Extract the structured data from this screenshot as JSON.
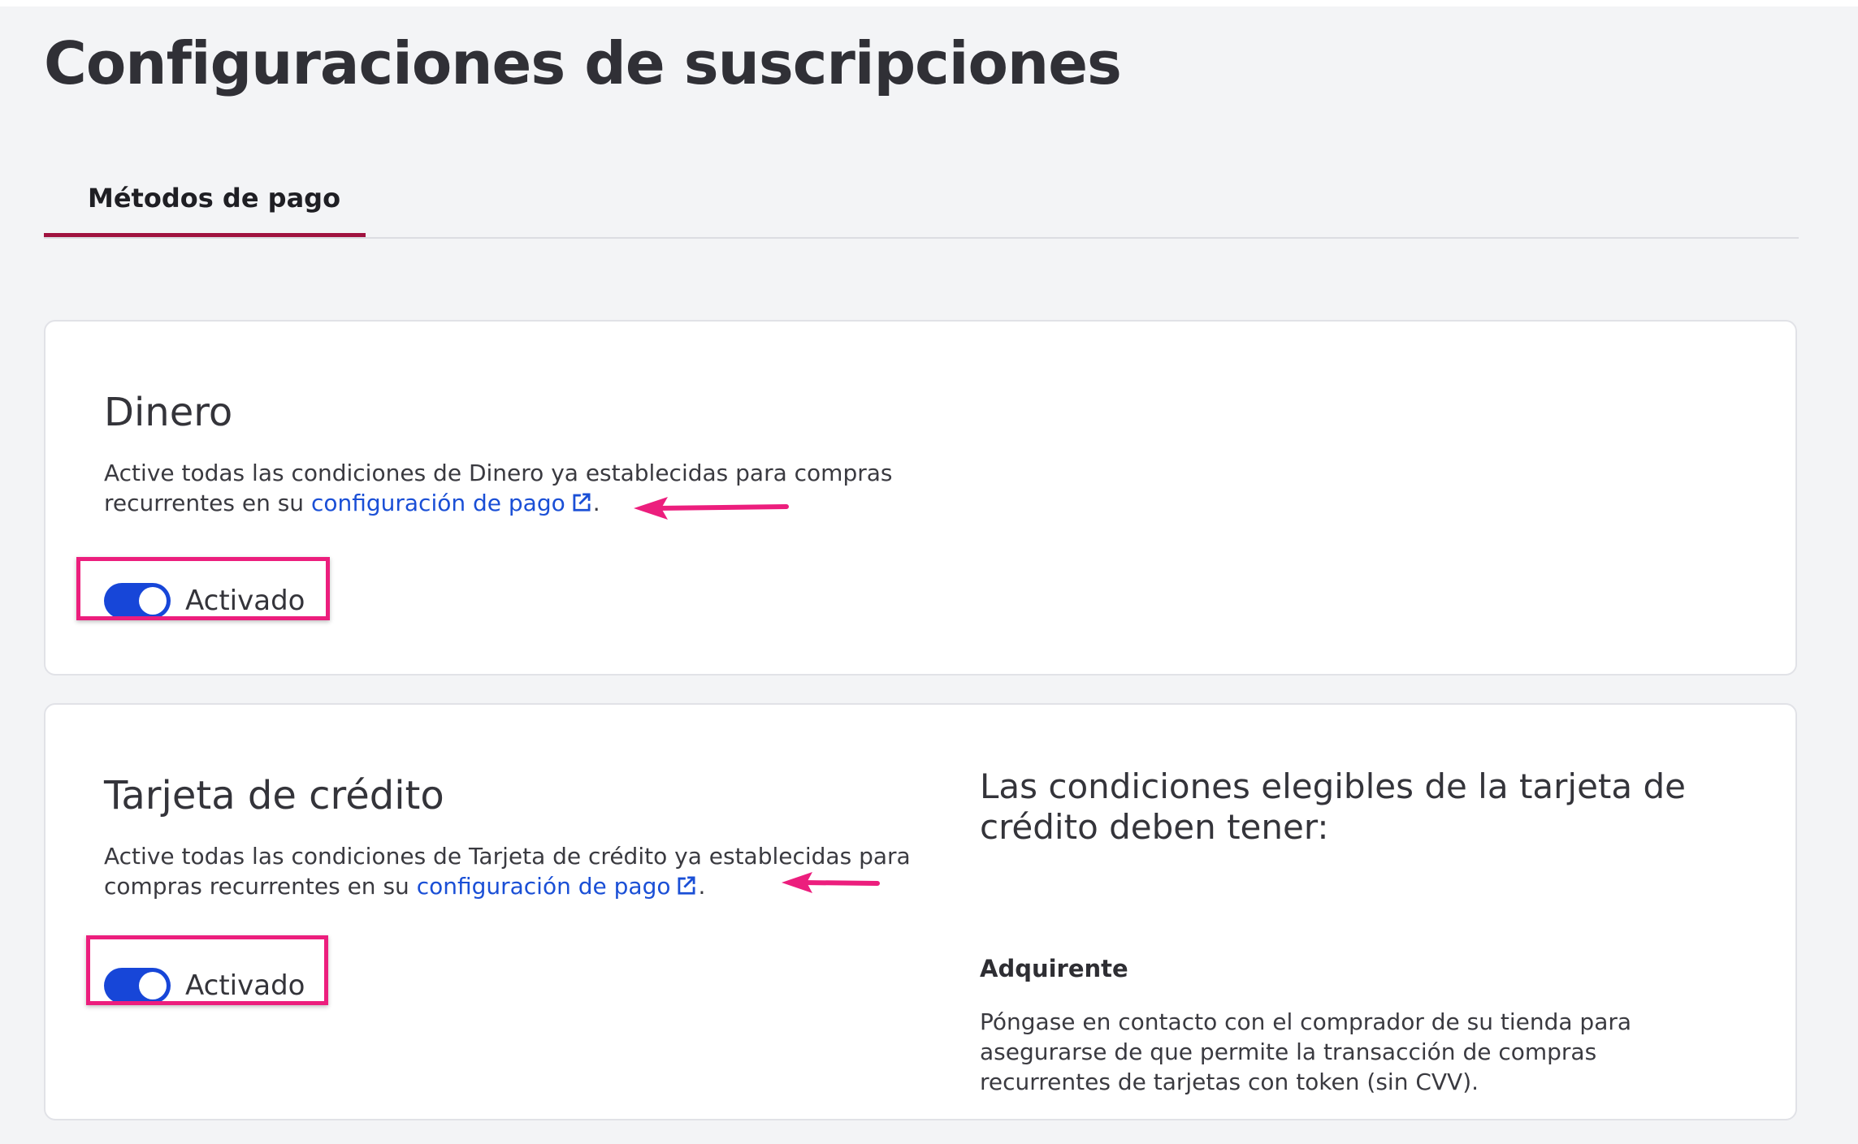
{
  "page": {
    "title": "Configuraciones de suscripciones"
  },
  "tabs": [
    {
      "label": "Métodos de pago",
      "active": true
    }
  ],
  "cards": {
    "dinero": {
      "title": "Dinero",
      "description_before": "Active todas las condiciones de Dinero ya establecidas para compras recurrentes en su ",
      "link_text": "configuración de pago",
      "description_after": ".",
      "toggle_label": "Activado",
      "toggle_on": true
    },
    "tarjeta": {
      "title": "Tarjeta de crédito",
      "description_before": "Active todas las condiciones de Tarjeta de crédito ya establecidas para compras recurrentes en su ",
      "link_text": "configuración de pago",
      "description_after": ".",
      "toggle_label": "Activado",
      "toggle_on": true,
      "eligibility": {
        "heading": "Las condiciones elegibles de la tarjeta de crédito deben tener:",
        "subheading": "Adquirente",
        "body": "Póngase en contacto con el comprador de su tienda para asegurarse de que permite la transacción de compras recurrentes de tarjetas con token (sin CVV)."
      }
    }
  },
  "icons": {
    "link_icon": "external-link-icon",
    "annotation_arrow": "arrow-left-icon"
  },
  "colors": {
    "accent_tab": "#a0123f",
    "toggle_on": "#1746d8",
    "link": "#1a4fd6",
    "annotation": "#ec1e7d",
    "background": "#f3f4f6",
    "card": "#ffffff"
  }
}
